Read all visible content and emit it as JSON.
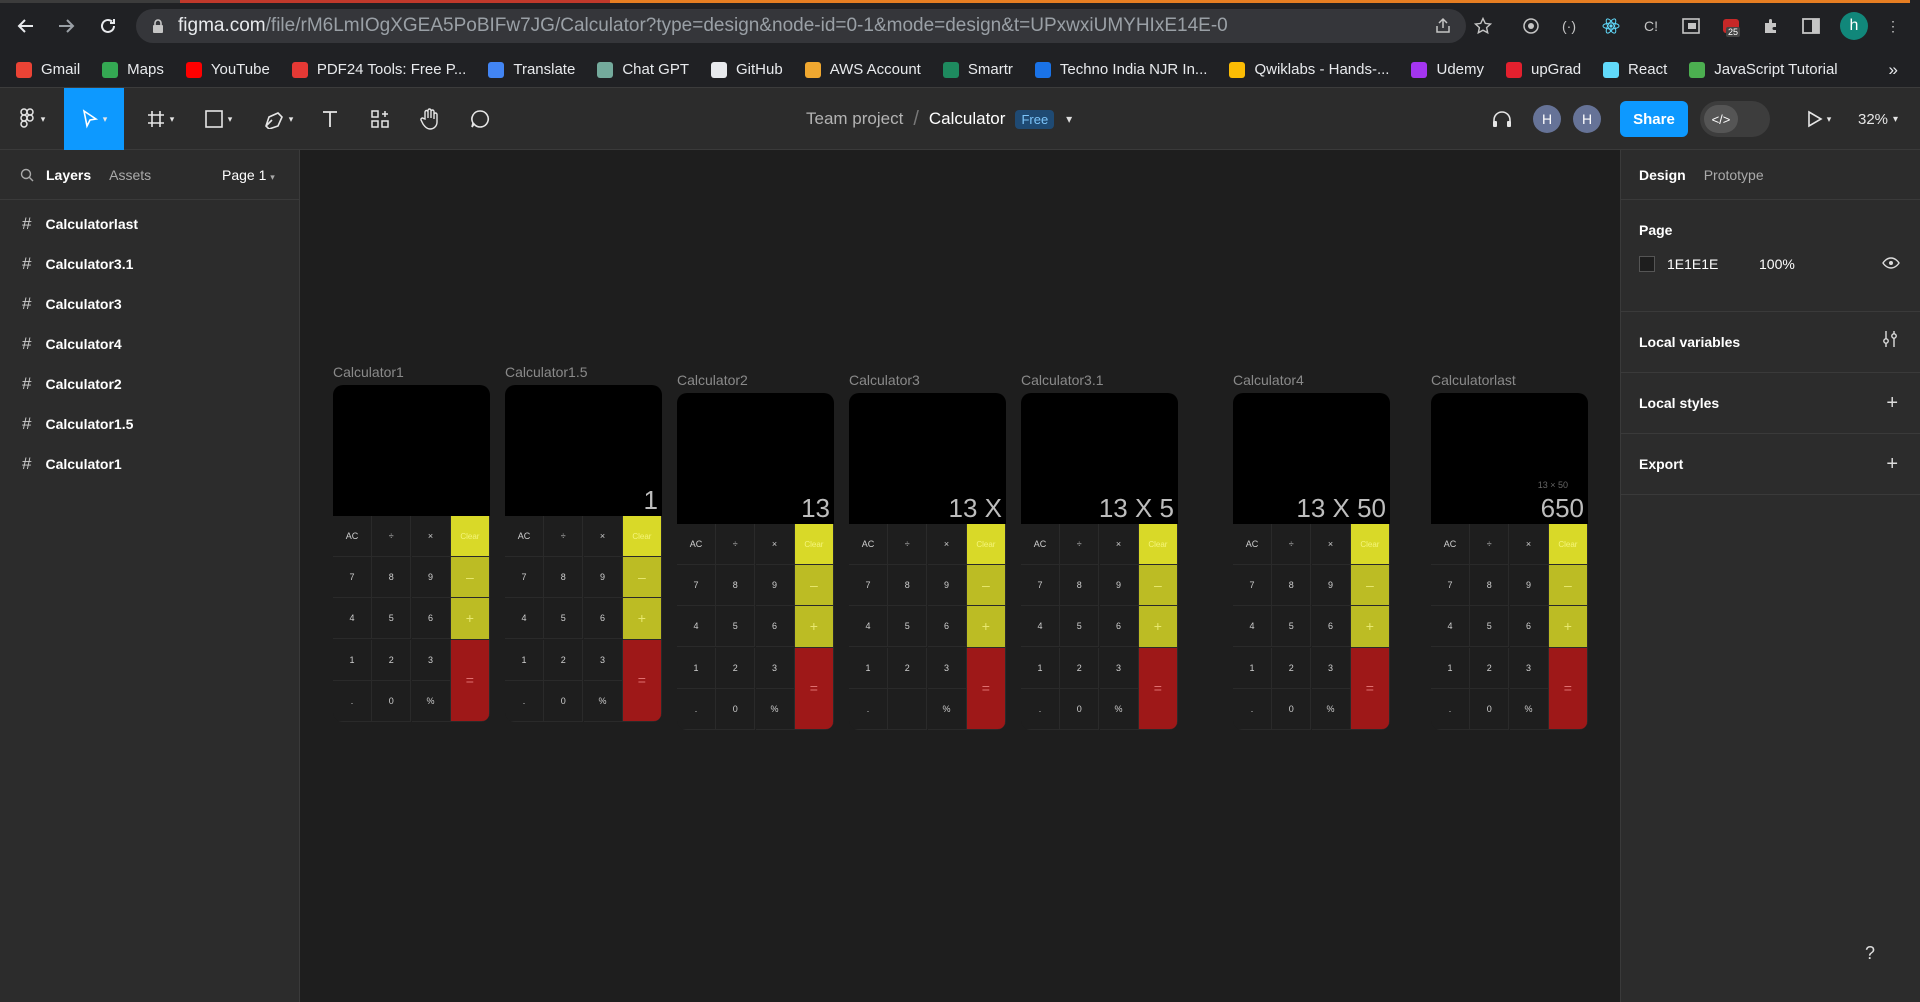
{
  "browser": {
    "url_host": "figma.com",
    "url_path": "/file/rM6LmIOgXGEA5PoBIFw7JG/Calculator?type=design&node-id=0-1&mode=design&t=UPxwxiUMYHIxE14E-0",
    "ext_badge": "25",
    "profile_initial": "h",
    "bookmarks": [
      {
        "label": "Gmail",
        "color": "#ea4335"
      },
      {
        "label": "Maps",
        "color": "#34a853"
      },
      {
        "label": "YouTube",
        "color": "#ff0000"
      },
      {
        "label": "PDF24 Tools: Free P...",
        "color": "#e53935"
      },
      {
        "label": "Translate",
        "color": "#4285f4"
      },
      {
        "label": "Chat GPT",
        "color": "#74aa9c"
      },
      {
        "label": "GitHub",
        "color": "#e8eaed"
      },
      {
        "label": "AWS Account",
        "color": "#f0a830"
      },
      {
        "label": "Smartr",
        "color": "#1e8a5f"
      },
      {
        "label": "Techno India NJR In...",
        "color": "#1a73e8"
      },
      {
        "label": "Qwiklabs - Hands-...",
        "color": "#fbbc04"
      },
      {
        "label": "Udemy",
        "color": "#a435f0"
      },
      {
        "label": "upGrad",
        "color": "#e3202e"
      },
      {
        "label": "React",
        "color": "#61dafb"
      },
      {
        "label": "JavaScript Tutorial",
        "color": "#4caf50"
      }
    ],
    "more": "»"
  },
  "toolbar": {
    "team": "Team project",
    "file": "Calculator",
    "plan_badge": "Free",
    "collaborators": [
      "H",
      "H"
    ],
    "share_label": "Share",
    "zoom": "32%"
  },
  "left_panel": {
    "tabs": [
      "Layers",
      "Assets"
    ],
    "page": "Page 1",
    "layers": [
      "Calculatorlast",
      "Calculator3.1",
      "Calculator3",
      "Calculator4",
      "Calculator2",
      "Calculator1.5",
      "Calculator1"
    ]
  },
  "right_panel": {
    "tabs": [
      "Design",
      "Prototype"
    ],
    "page_title": "Page",
    "page_color": "1E1E1E",
    "page_opacity": "100%",
    "local_variables": "Local variables",
    "local_styles": "Local styles",
    "export": "Export"
  },
  "frames": [
    {
      "name": "Calculator1",
      "display": "",
      "sub": "",
      "zero": "0"
    },
    {
      "name": "Calculator1.5",
      "display": "1",
      "sub": "",
      "zero": "0"
    },
    {
      "name": "Calculator2",
      "display": "13",
      "sub": "",
      "zero": "0"
    },
    {
      "name": "Calculator3",
      "display": "13 X",
      "sub": "",
      "zero": ""
    },
    {
      "name": "Calculator3.1",
      "display": "13 X 5",
      "sub": "",
      "zero": "0"
    },
    {
      "name": "Calculator4",
      "display": "13 X 50",
      "sub": "",
      "zero": "0"
    },
    {
      "name": "Calculatorlast",
      "display": "650",
      "sub": "13 × 50",
      "zero": "0"
    }
  ],
  "keypad": {
    "row1": [
      "AC",
      "÷",
      "×"
    ],
    "row2": [
      "7",
      "8",
      "9"
    ],
    "row3": [
      "4",
      "5",
      "6"
    ],
    "row4": [
      "1",
      "2",
      "3"
    ],
    "row5": [
      ".",
      "0",
      "%"
    ],
    "clear": "Clear",
    "minus": "–",
    "plus": "+",
    "equals": "="
  },
  "help": "?"
}
